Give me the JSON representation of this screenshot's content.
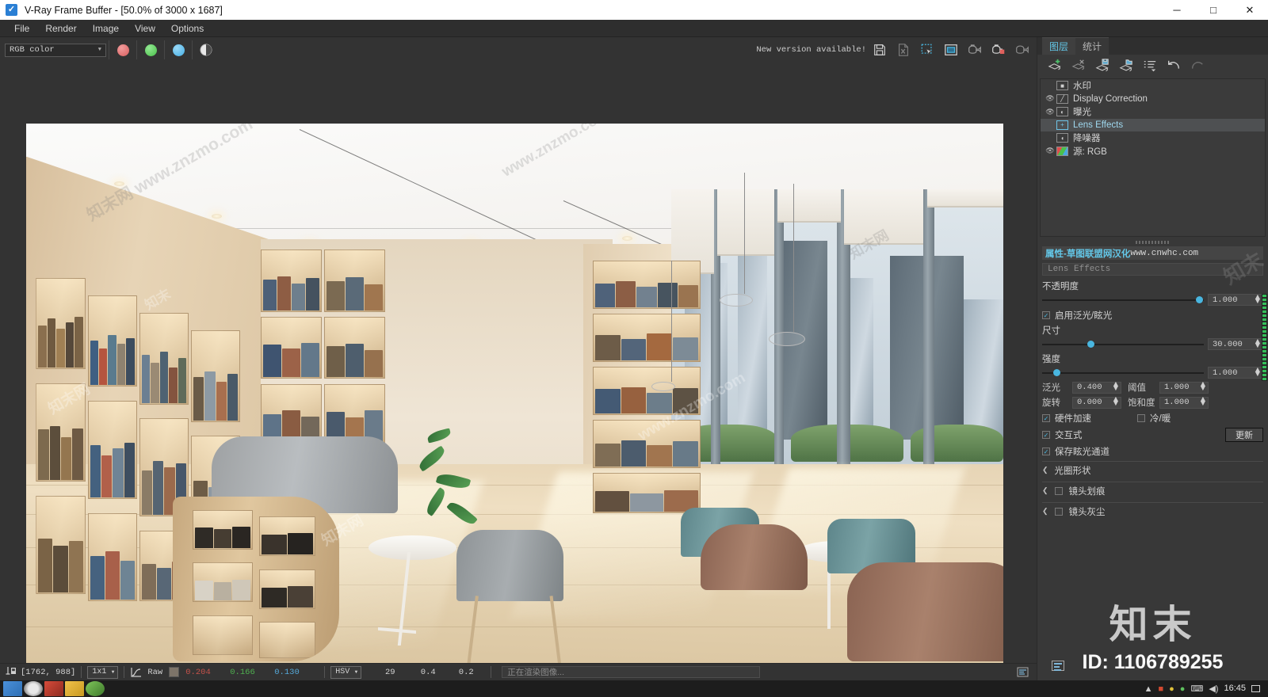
{
  "window": {
    "title": "V-Ray Frame Buffer - [50.0% of 3000 x 1687]",
    "app_icon": "vray-checkbox-icon",
    "minimize": "─",
    "maximize": "□",
    "close": "✕"
  },
  "menubar": {
    "items": [
      "File",
      "Render",
      "Image",
      "View",
      "Options"
    ]
  },
  "toolbar": {
    "channel_value": "RGB color",
    "channel_caret": "▼",
    "color_dots": [
      {
        "name": "red-channel-dot",
        "color": "#e07070"
      },
      {
        "name": "green-channel-dot",
        "color": "#5fd25f"
      },
      {
        "name": "blue-channel-dot",
        "color": "#5fbdf0"
      }
    ],
    "alpha_icon": "alpha-channel-icon",
    "new_version_text": "New version available!",
    "right_buttons": [
      "save-image-icon",
      "save-all-channels-icon",
      "region-render-icon",
      "show-vfb-window-icon",
      "render-last-icon",
      "render-icon",
      "stop-render-icon"
    ]
  },
  "render": {
    "scene": "office-library-interior",
    "watermarks": [
      "知末网",
      "www.znzmo.com"
    ]
  },
  "statusbar": {
    "pick_icon": "color-picker-icon",
    "coords": "[1762, 988]",
    "sample_size": "1x1",
    "curve_icon": "color-curve-icon",
    "mode": "Raw",
    "swatch_color": "#7d7469",
    "r": "0.204",
    "g": "0.166",
    "b": "0.130",
    "r_color": "#c4524a",
    "g_color": "#4fae4f",
    "b_color": "#55a8d8",
    "color_space": "HSV",
    "h": "29",
    "s": "0.4",
    "v": "0.2",
    "progress_text": "正在渲染图像...",
    "right_icon": "log-panel-icon"
  },
  "panel": {
    "tabs": [
      {
        "label": "图层",
        "active": true
      },
      {
        "label": "统计",
        "active": false
      }
    ],
    "layer_tools": [
      "add-layer-icon",
      "delete-layer-icon",
      "save-layer-icon",
      "load-layer-icon",
      "layer-menu-icon",
      "undo-icon",
      "redo-icon"
    ],
    "layers": [
      {
        "name": "水印",
        "eye": false,
        "type_icon": "watermark-icon",
        "selected": false
      },
      {
        "name": "Display Correction",
        "eye": true,
        "type_icon": "curve-icon",
        "selected": false
      },
      {
        "name": "曝光",
        "eye": true,
        "type_icon": "exposure-icon",
        "selected": false
      },
      {
        "name": "Lens Effects",
        "eye": false,
        "type_icon": "lens-effects-icon",
        "selected": true
      },
      {
        "name": "降噪器",
        "eye": false,
        "type_icon": "denoiser-icon",
        "selected": false
      },
      {
        "name": "源: RGB",
        "eye": true,
        "type_icon": "source-rgb-icon",
        "selected": false
      }
    ],
    "properties": {
      "header": "属性-草图联盟网汉化",
      "header_watermark": "www.cnwhc.com",
      "effect_name": "Lens Effects",
      "opacity_label": "不透明度",
      "opacity_value": "1.000",
      "opacity_pct": 97,
      "enable_bloom_label": "启用泛光/眩光",
      "enable_bloom_checked": true,
      "size_label": "尺寸",
      "size_value": "30.000",
      "size_pct": 30,
      "intensity_label": "强度",
      "intensity_value": "1.000",
      "intensity_pct": 8,
      "bloom_label": "泛光",
      "bloom_value": "0.400",
      "threshold_label": "阈值",
      "threshold_value": "1.000",
      "rotate_label": "旋转",
      "rotate_value": "0.000",
      "saturation_label": "饱和度",
      "saturation_value": "1.000",
      "hw_accel_label": "硬件加速",
      "hw_accel_checked": true,
      "cool_warm_label": "冷/暖",
      "cool_warm_checked": false,
      "interactive_label": "交互式",
      "interactive_checked": true,
      "save_glare_label": "保存眩光通道",
      "save_glare_checked": true,
      "update_button": "更新",
      "sections": [
        {
          "label": "光圈形状",
          "checkbox": false,
          "has_checkbox": false
        },
        {
          "label": "镜头划痕",
          "checkbox": false,
          "has_checkbox": true
        },
        {
          "label": "镜头灰尘",
          "checkbox": false,
          "has_checkbox": true
        }
      ],
      "chevron": "⌄"
    },
    "brand_logo": "知末",
    "brand_id": "ID: 1106789255",
    "brand_watermark": "知末"
  },
  "taskbar": {
    "icons": [
      "start-icon",
      "cortana-icon",
      "pdf-icon",
      "folder-icon",
      "app-green-icon"
    ],
    "tray": [
      "▲",
      "■",
      "●",
      "●",
      "⌨",
      "◀)"
    ],
    "clock": "16:45",
    "notification_icon": "notification-icon"
  },
  "colors": {
    "accent": "#49b6e0",
    "tab_active": "#63c7e8",
    "panel_bg": "#383838"
  }
}
